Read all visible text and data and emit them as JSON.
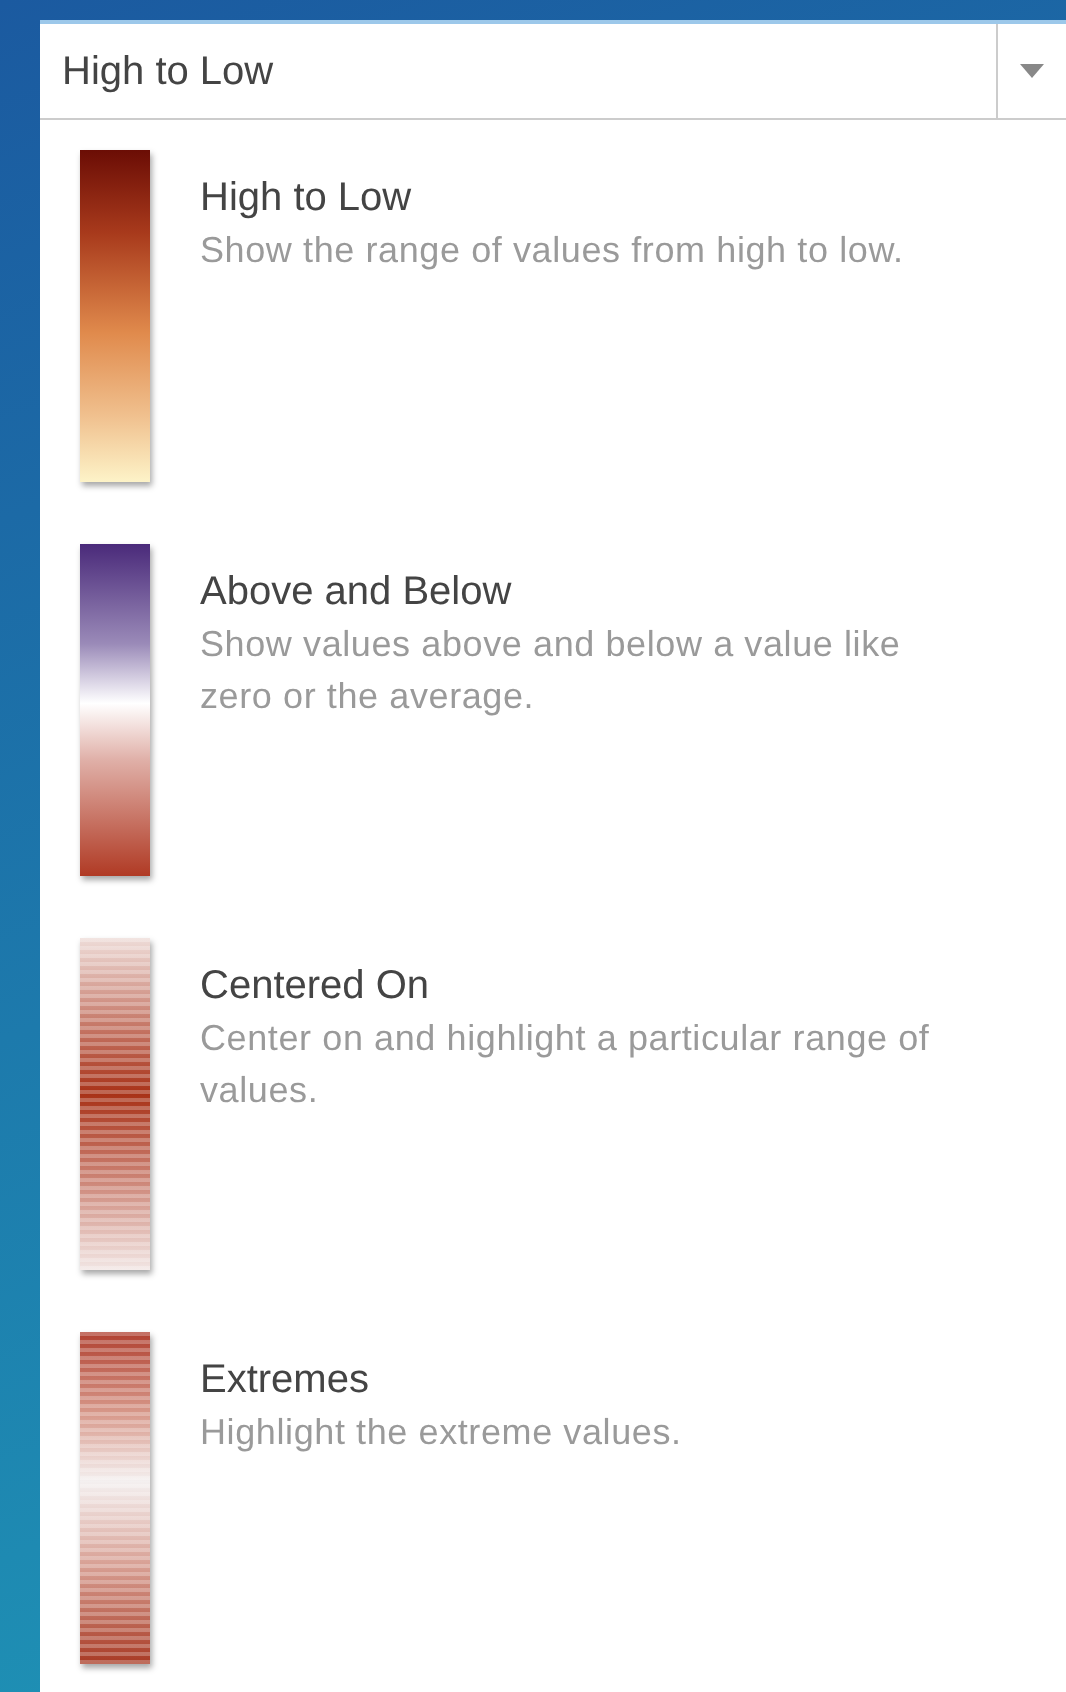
{
  "dropdown": {
    "value": "High to Low"
  },
  "styles": [
    {
      "kind": "sequential",
      "title": "High to Low",
      "description": "Show the range of values from high to low."
    },
    {
      "kind": "diverging",
      "title": "Above and Below",
      "description": "Show values above and below a value like zero or the average."
    },
    {
      "kind": "centered",
      "title": "Centered On",
      "description": "Center on and highlight a particular range of values."
    },
    {
      "kind": "extremes",
      "title": "Extremes",
      "description": "Highlight the extreme values."
    }
  ]
}
